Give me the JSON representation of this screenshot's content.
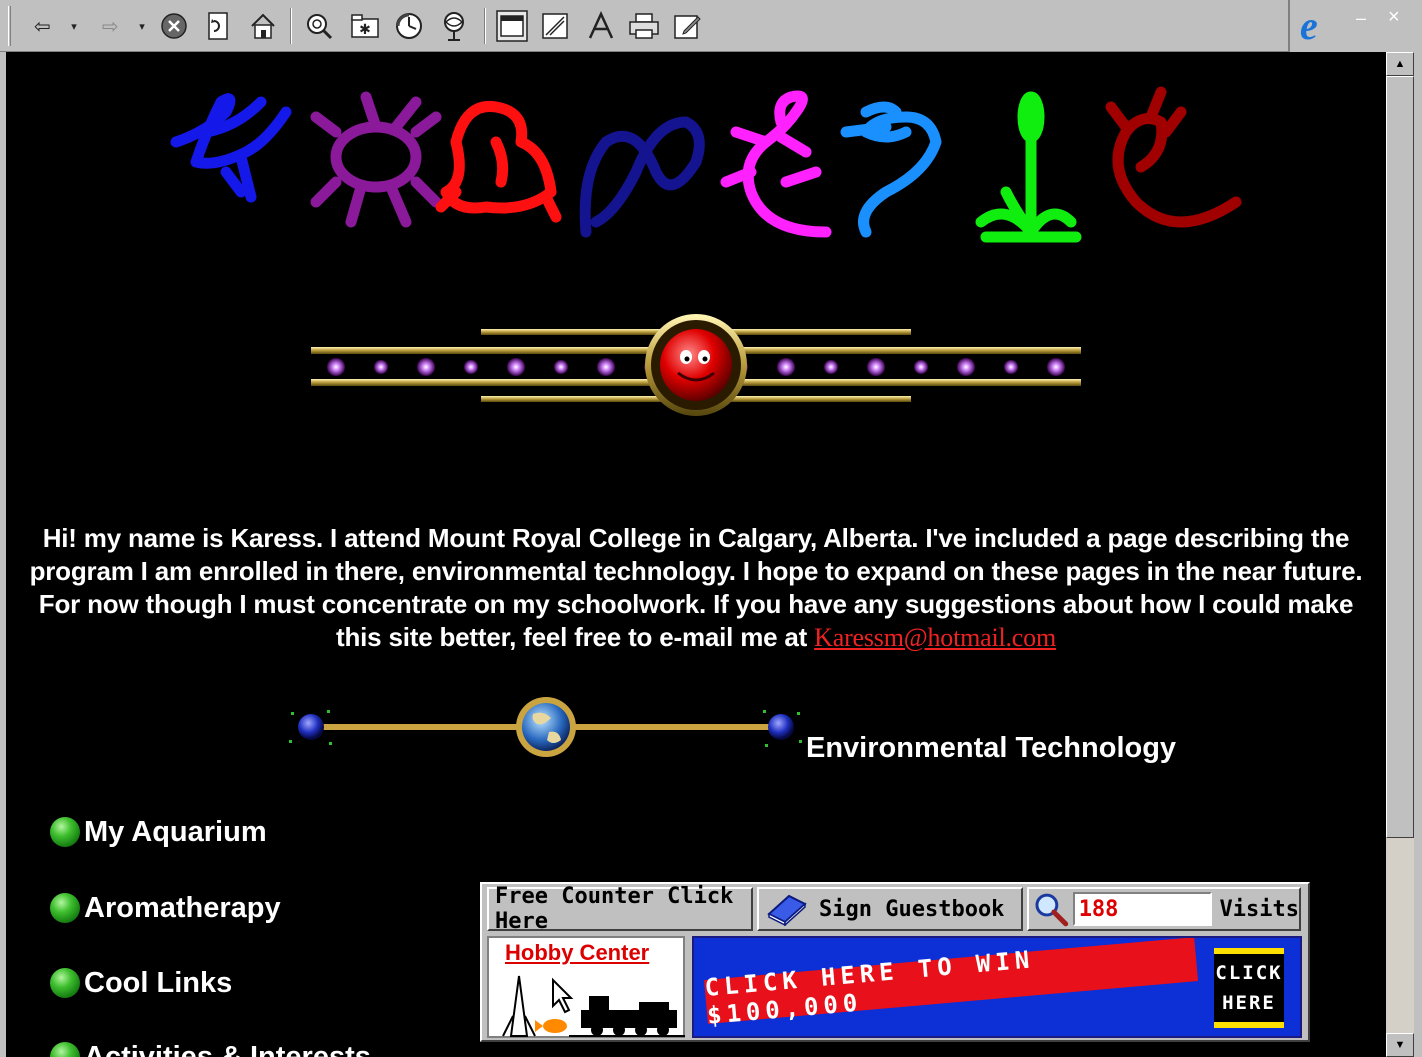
{
  "intro": {
    "text": "Hi! my name is Karess. I attend Mount Royal College in Calgary, Alberta. I've included a page describing the program I am enrolled in there, environmental technology. I hope to expand on these pages in the near future. For now though I must concentrate on my schoolwork. If you have any suggestions about how I could make this site better, feel free to e-mail me at",
    "email_link": "Karessm@hotmail.com"
  },
  "env_link": "Environmental Technology",
  "nav": [
    {
      "label": "My Aquarium"
    },
    {
      "label": "Aromatherapy"
    },
    {
      "label": "Cool Links"
    },
    {
      "label": "Activities & Interests"
    }
  ],
  "counter": {
    "free_counter_label": "Free Counter Click Here",
    "guestbook_label": "Sign Guestbook",
    "visits_count": "188",
    "visits_label": "Visits"
  },
  "ads": {
    "hobby_title": "Hobby Center",
    "win_text": "CLICK HERE TO WIN $100,000",
    "click_line1": "CLICK",
    "click_line2": "HERE"
  },
  "colors": {
    "background": "#000000",
    "link": "#ee2222",
    "bullet": "#3fbf2f",
    "ad_blue": "#0d2fd6",
    "ad_red": "#e8101a"
  },
  "icons": {
    "toolbar": [
      "back-icon",
      "forward-icon",
      "stop-icon",
      "refresh-icon",
      "home-icon",
      "search-icon",
      "favorites-icon",
      "history-icon",
      "channels-icon",
      "fullscreen-icon",
      "mail-icon",
      "font-icon",
      "print-icon",
      "edit-icon"
    ]
  }
}
